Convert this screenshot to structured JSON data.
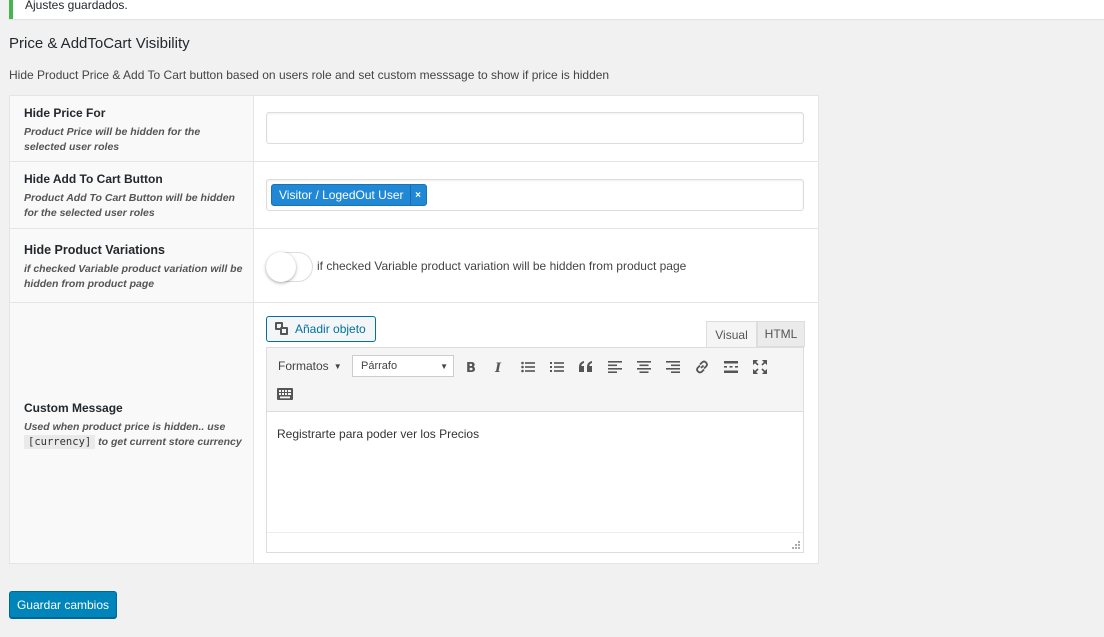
{
  "notice": {
    "text": "Ajustes guardados."
  },
  "page": {
    "title": "Price & AddToCart Visibility",
    "description": "Hide Product Price & Add To Cart button based on users role and set custom messsage to show if price is hidden"
  },
  "settings": {
    "hide_price": {
      "title": "Hide Price For",
      "desc": "Product Price will be hidden for the selected user roles"
    },
    "hide_cart": {
      "title": "Hide Add To Cart Button",
      "desc": "Product Add To Cart Button will be hidden for the selected user roles",
      "tag": "Visitor / LogedOut User",
      "tag_remove": "×"
    },
    "hide_variations": {
      "title": "Hide Product Variations",
      "desc": "if checked Variable product variation will be hidden from product page",
      "toggle_label": "if checked Variable product variation will be hidden from product page",
      "checked": false
    },
    "custom_message": {
      "title": "Custom Message",
      "desc_before": "Used when product price is hidden.. use",
      "desc_code": "[currency]",
      "desc_after": "to get current store currency"
    }
  },
  "editor": {
    "add_media": "Añadir objeto",
    "tab_visual": "Visual",
    "tab_html": "HTML",
    "formats": "Formatos",
    "paragraph": "Párrafo",
    "content": "Registrarte para poder ver los  Precios",
    "toolbar_icons": [
      "bold-icon",
      "italic-icon",
      "bullet-list-icon",
      "numbered-list-icon",
      "blockquote-icon",
      "align-left-icon",
      "align-center-icon",
      "align-right-icon",
      "link-icon",
      "read-more-icon",
      "fullscreen-icon",
      "keyboard-icon"
    ]
  },
  "actions": {
    "save": "Guardar cambios"
  },
  "colors": {
    "primary": "#0085ba",
    "tag": "#2188d5",
    "notice_border": "#46b450"
  }
}
